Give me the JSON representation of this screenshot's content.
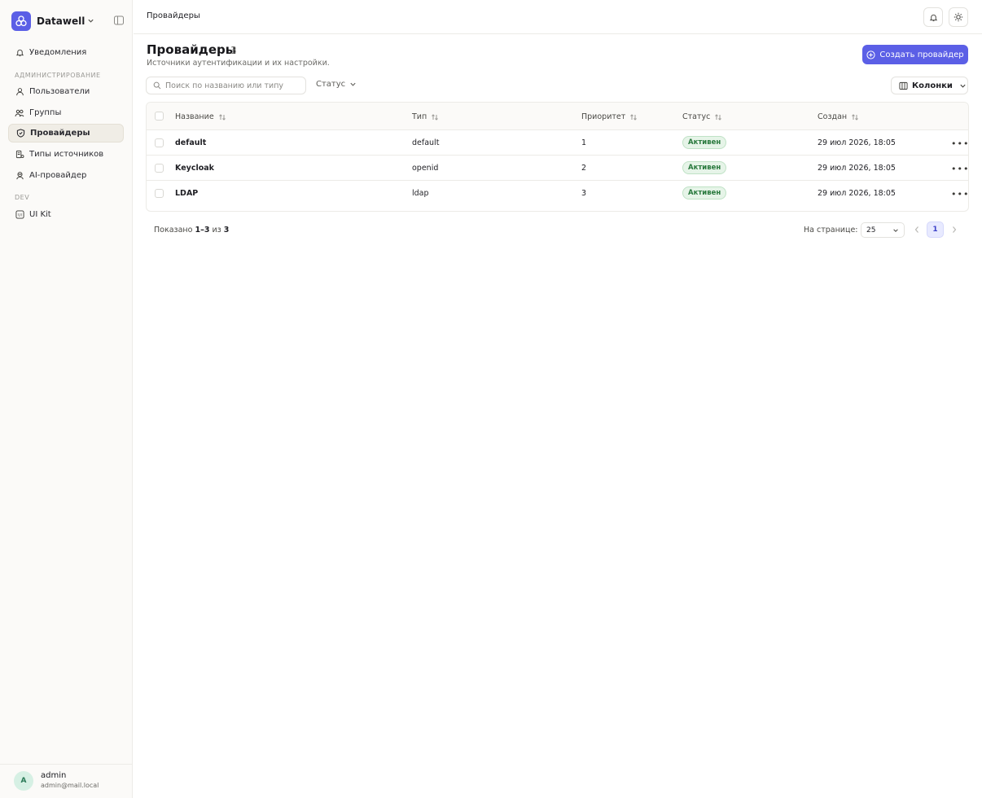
{
  "sidebar": {
    "brand": "Datawell",
    "items": [
      {
        "label": "Уведомления"
      },
      {
        "label": "Пользователи"
      },
      {
        "label": "Группы"
      },
      {
        "label": "Провайдеры"
      },
      {
        "label": "Типы источников"
      },
      {
        "label": "AI-провайдер"
      },
      {
        "label": "UI Kit"
      }
    ],
    "sections": {
      "admin": "АДМИНИСТРИРОВАНИЕ",
      "dev": "DEV"
    },
    "user": {
      "initial": "A",
      "name": "admin",
      "email": "admin@mail.local"
    }
  },
  "header": {
    "breadcrumb": "Провайдеры"
  },
  "main": {
    "title": "Провайдеры",
    "count": "3",
    "subtitle": "Источники аутентификации и их настройки.",
    "create_label": "Создать провайдер",
    "search_placeholder": "Поиск по названию или типу",
    "status_filter": "Статус",
    "columns_label": "Колонки"
  },
  "table": {
    "columns": [
      "Название",
      "Тип",
      "Приоритет",
      "Статус",
      "Создан"
    ],
    "rows": [
      {
        "name": "default",
        "type": "default",
        "priority": "1",
        "status": "Активен",
        "created": "29 июл 2026, 18:05"
      },
      {
        "name": "Keycloak",
        "type": "openid",
        "priority": "2",
        "status": "Активен",
        "created": "29 июл 2026, 18:05"
      },
      {
        "name": "LDAP",
        "type": "ldap",
        "priority": "3",
        "status": "Активен",
        "created": "29 июл 2026, 18:05"
      }
    ]
  },
  "footer": {
    "shown_prefix": "Показано",
    "shown_range": "1–3",
    "shown_of": "из",
    "shown_total": "3",
    "per_page_label": "На странице:",
    "per_page_value": "25",
    "current_page": "1"
  },
  "colors": {
    "accent": "#5b5fe6",
    "active_badge_bg": "#e6f4e8",
    "active_badge_text": "#2a7a3e"
  }
}
